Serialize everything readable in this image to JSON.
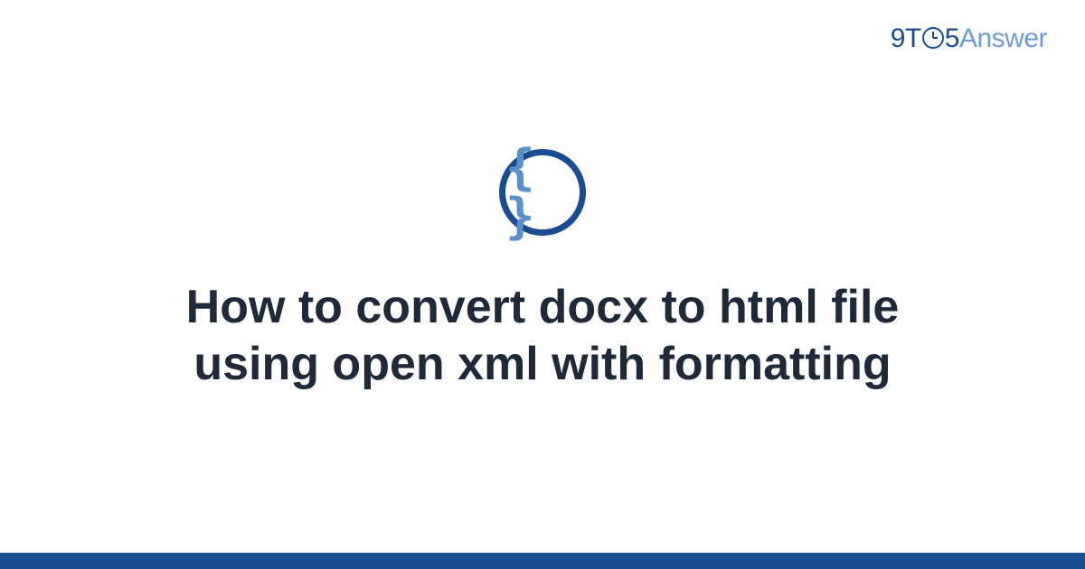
{
  "brand": {
    "prefix": "9T",
    "middle": "5",
    "suffix": "Answer"
  },
  "category_icon": {
    "name": "code-braces-icon",
    "glyph": "{ }"
  },
  "title": "How to convert docx to html file using open xml with formatting",
  "colors": {
    "primary": "#1a4d8f",
    "accent": "#5b8fc9",
    "text": "#1f2937"
  }
}
